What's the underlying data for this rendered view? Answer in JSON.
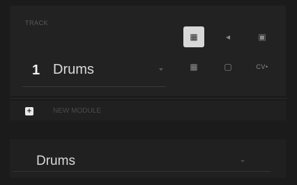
{
  "panel": {
    "label": "TRACK",
    "track_number": "1",
    "track_name": "Drums",
    "tools": [
      {
        "icon": "grid-icon",
        "glyph": "▦",
        "active": true
      },
      {
        "icon": "speaker-icon",
        "glyph": "◂"
      },
      {
        "icon": "save-icon",
        "glyph": "▣"
      },
      {
        "icon": "grid-small-icon",
        "glyph": "▦"
      },
      {
        "icon": "square-icon",
        "glyph": "▢"
      },
      {
        "icon": "cv-icon",
        "glyph": "CV•"
      }
    ]
  },
  "add_row": {
    "icon": "add-icon",
    "glyph": "+",
    "label": "NEW MODULE"
  },
  "module": {
    "name": "Drums"
  }
}
